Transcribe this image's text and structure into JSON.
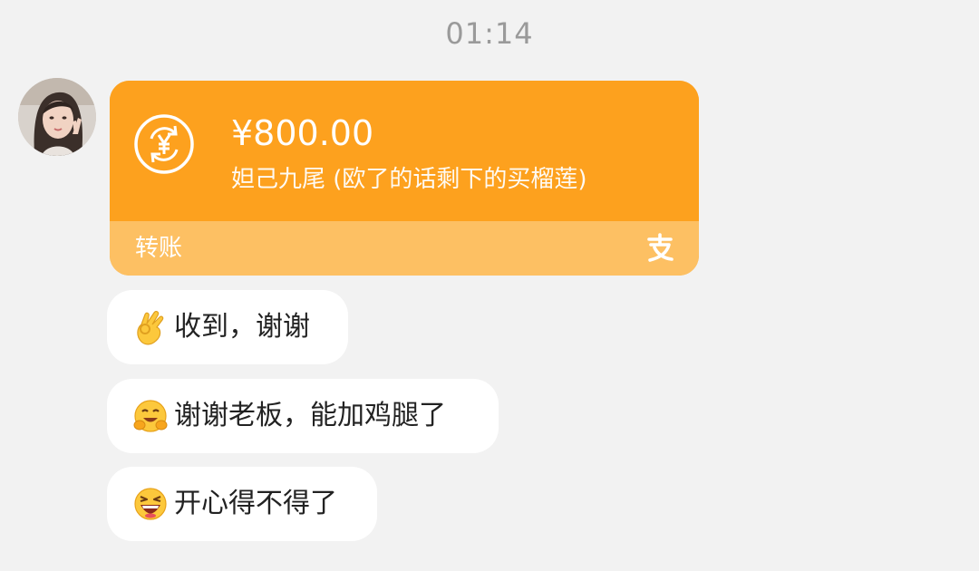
{
  "timestamp": "01:14",
  "transfer": {
    "amount": "¥800.00",
    "note": "妲己九尾 (欧了的话剩下的买榴莲)",
    "label": "转账",
    "icon": "currency-exchange-icon",
    "provider_icon": "alipay-icon"
  },
  "messages": [
    {
      "emoji": "ok-hand-emoji",
      "text": "收到，谢谢"
    },
    {
      "emoji": "hugging-face-emoji",
      "text": "谢谢老板，能加鸡腿了"
    },
    {
      "emoji": "laughing-face-emoji",
      "text": "开心得不得了"
    }
  ],
  "colors": {
    "background": "#f2f2f2",
    "card_top": "#fda11e",
    "card_bottom": "#fdc063",
    "bubble": "#ffffff",
    "timestamp": "#9a9a9a"
  }
}
